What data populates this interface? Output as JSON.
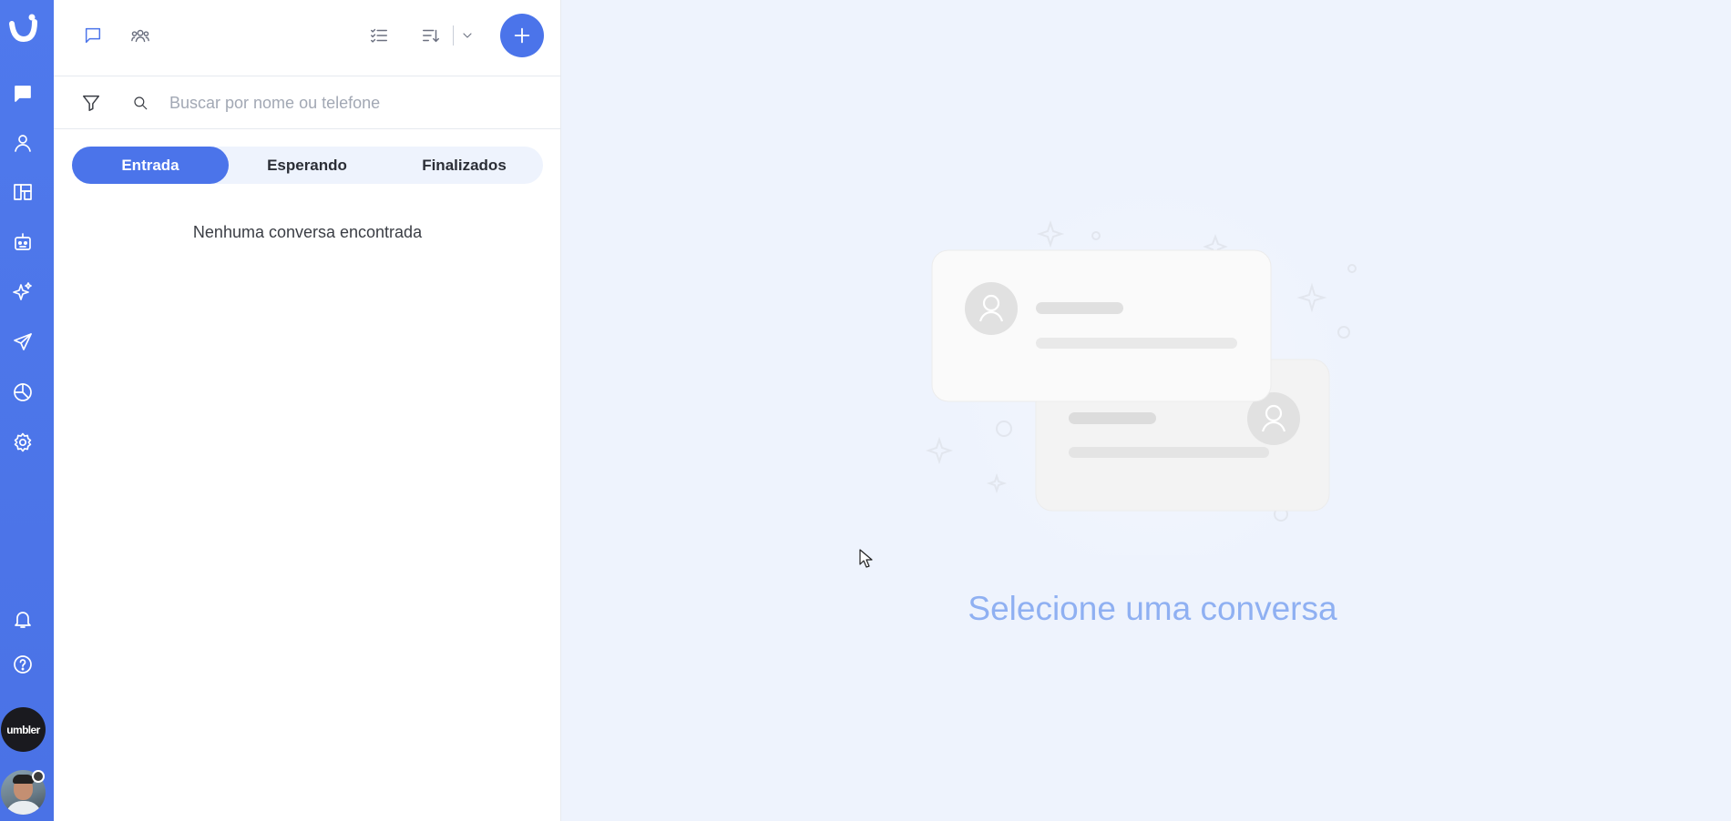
{
  "rail": {
    "items": [
      {
        "name": "conversations",
        "icon": "chat-icon"
      },
      {
        "name": "contacts",
        "icon": "user-icon"
      },
      {
        "name": "kanban",
        "icon": "kanban-icon"
      },
      {
        "name": "bots",
        "icon": "robot-icon"
      },
      {
        "name": "ai",
        "icon": "sparkles-icon"
      },
      {
        "name": "campaigns",
        "icon": "send-icon"
      },
      {
        "name": "reports",
        "icon": "pie-chart-icon"
      },
      {
        "name": "settings",
        "icon": "gear-icon"
      }
    ],
    "bottom": [
      {
        "name": "notifications",
        "icon": "bell-icon"
      },
      {
        "name": "help",
        "icon": "help-icon"
      }
    ],
    "org_label": "umbler"
  },
  "toolbar": {
    "icons": [
      "chat-outline-icon",
      "group-icon",
      "checklist-icon",
      "sort-icon",
      "chevron-down-icon",
      "plus-icon"
    ]
  },
  "search": {
    "placeholder": "Buscar por nome ou telefone",
    "value": ""
  },
  "tabs": [
    {
      "label": "Entrada",
      "active": true
    },
    {
      "label": "Esperando",
      "active": false
    },
    {
      "label": "Finalizados",
      "active": false
    }
  ],
  "list": {
    "empty_message": "Nenhuma conversa encontrada"
  },
  "main": {
    "empty_title": "Selecione uma conversa"
  },
  "colors": {
    "brand": "#4b74ea",
    "rail": "#4f79ec",
    "background": "#eef3fd",
    "empty_title": "#8fb0f2"
  }
}
